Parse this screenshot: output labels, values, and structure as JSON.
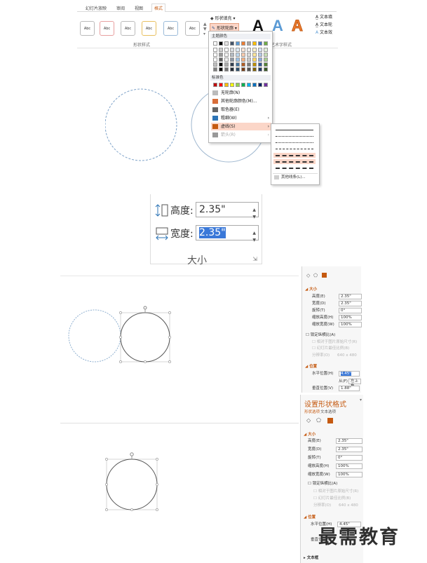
{
  "ribbon": {
    "tabs": [
      "幻灯片放映",
      "审阅",
      "视图",
      "格式"
    ],
    "style_label": "Abc",
    "shape_styles_group": "形状样式",
    "fill_cmd": "形状填充",
    "outline_cmd": "形状轮廓",
    "wordart_letter": "A",
    "wordart_group": "艺术字样式",
    "text_fill": "文本填",
    "text_outline": "文本轮",
    "text_effects": "文本效"
  },
  "outline_menu": {
    "theme_colors": "主题颜色",
    "standard_colors": "标准色",
    "items": [
      {
        "label": "无轮廓(N)",
        "icon": "no-outline-icon",
        "arrow": ""
      },
      {
        "label": "其他轮廓颜色(M)...",
        "icon": "color-wheel-icon",
        "arrow": ""
      },
      {
        "label": "取色器(E)",
        "icon": "eyedropper-icon",
        "arrow": ""
      },
      {
        "label": "粗细(W)",
        "icon": "line-weight-icon",
        "arrow": "›"
      },
      {
        "label": "虚线(S)",
        "icon": "dash-icon",
        "arrow": "›"
      },
      {
        "label": "箭头(R)",
        "icon": "arrow-icon",
        "arrow": "›"
      }
    ],
    "more_lines": "其他线条(L)...",
    "colors": {
      "accent": "#c55a11",
      "highlight": "#fbd6c8",
      "standard": [
        "#c00000",
        "#ff0000",
        "#ffc000",
        "#ffff00",
        "#92d050",
        "#00b050",
        "#00b0f0",
        "#0070c0",
        "#002060",
        "#7030a0"
      ],
      "theme_top": [
        "#ffffff",
        "#000000",
        "#e7e6e6",
        "#44546a",
        "#5b9bd5",
        "#ed7d31",
        "#a5a5a5",
        "#ffc000",
        "#4472c4",
        "#70ad47"
      ]
    }
  },
  "size_panel": {
    "height_label": "高度:",
    "height_value": "2.35\"",
    "width_label": "宽度:",
    "width_value": "2.35\"",
    "group": "大小"
  },
  "format_panel_small": {
    "section_size": "大小",
    "rows": [
      {
        "label": "高度(E)",
        "value": "2.35\""
      },
      {
        "label": "宽度(D)",
        "value": "2.35\""
      },
      {
        "label": "旋转(T)",
        "value": "0°"
      },
      {
        "label": "缩放高度(H)",
        "value": "100%"
      },
      {
        "label": "缩放宽度(W)",
        "value": "100%"
      }
    ],
    "lock_ratio": "锁定纵横比(A)",
    "relative_orig": "相对于图片原始尺寸(R)",
    "best_scale": "幻灯片最佳比例(B)",
    "resolution_label": "分辨率(O)",
    "resolution_value": "640 x 480",
    "section_position": "位置",
    "h_pos_label": "水平位置(H)",
    "h_pos_value": "4.45\"",
    "from_label": "从(F)",
    "from_value": "左上角",
    "v_pos_label": "垂直位置(V)",
    "v_pos_value": "1.88\""
  },
  "format_panel_large": {
    "title": "设置形状格式",
    "tab_shape": "形状选项",
    "tab_text": "文本选项",
    "section_size": "大小",
    "rows": [
      {
        "label": "高度(E)",
        "value": "2.35\""
      },
      {
        "label": "宽度(D)",
        "value": "2.35\""
      },
      {
        "label": "旋转(T)",
        "value": "0°"
      },
      {
        "label": "缩放高度(H)",
        "value": "100%"
      },
      {
        "label": "缩放宽度(W)",
        "value": "100%"
      }
    ],
    "lock_ratio": "锁定纵横比(A)",
    "relative_orig": "相对于图片原始尺寸(R)",
    "best_scale": "幻灯片最佳比例(B)",
    "resolution_label": "分辨率(O)",
    "resolution_value": "640 x 480",
    "section_position": "位置",
    "h_pos_label": "水平位置(H)",
    "h_pos_value": "4.45\"",
    "v_pos_label": "垂直位置(V)",
    "section_textbox": "文本框"
  },
  "watermark": "最需教育"
}
